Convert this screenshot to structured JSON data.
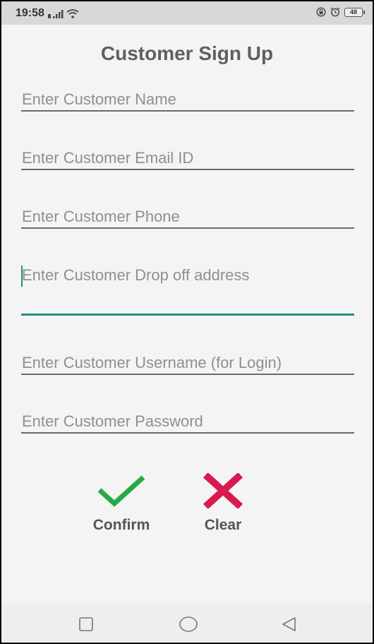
{
  "status_bar": {
    "time": "19:58",
    "battery_level": "48"
  },
  "page": {
    "title": "Customer Sign Up"
  },
  "form": {
    "name_placeholder": "Enter Customer Name",
    "email_placeholder": "Enter Customer Email ID",
    "phone_placeholder": "Enter Customer Phone",
    "address_placeholder": "Enter Customer Drop off address",
    "username_placeholder": "Enter Customer Username (for Login)",
    "password_placeholder": "Enter Customer Password",
    "focused_field": "address"
  },
  "actions": {
    "confirm_label": "Confirm",
    "clear_label": "Clear"
  },
  "colors": {
    "accent": "#1f8f85",
    "confirm": "#27a94a",
    "clear": "#d81b4f"
  },
  "icons": {
    "confirm": "check-icon",
    "clear": "cross-icon",
    "nav_recents": "square-icon",
    "nav_home": "circle-icon",
    "nav_back": "triangle-back-icon"
  }
}
